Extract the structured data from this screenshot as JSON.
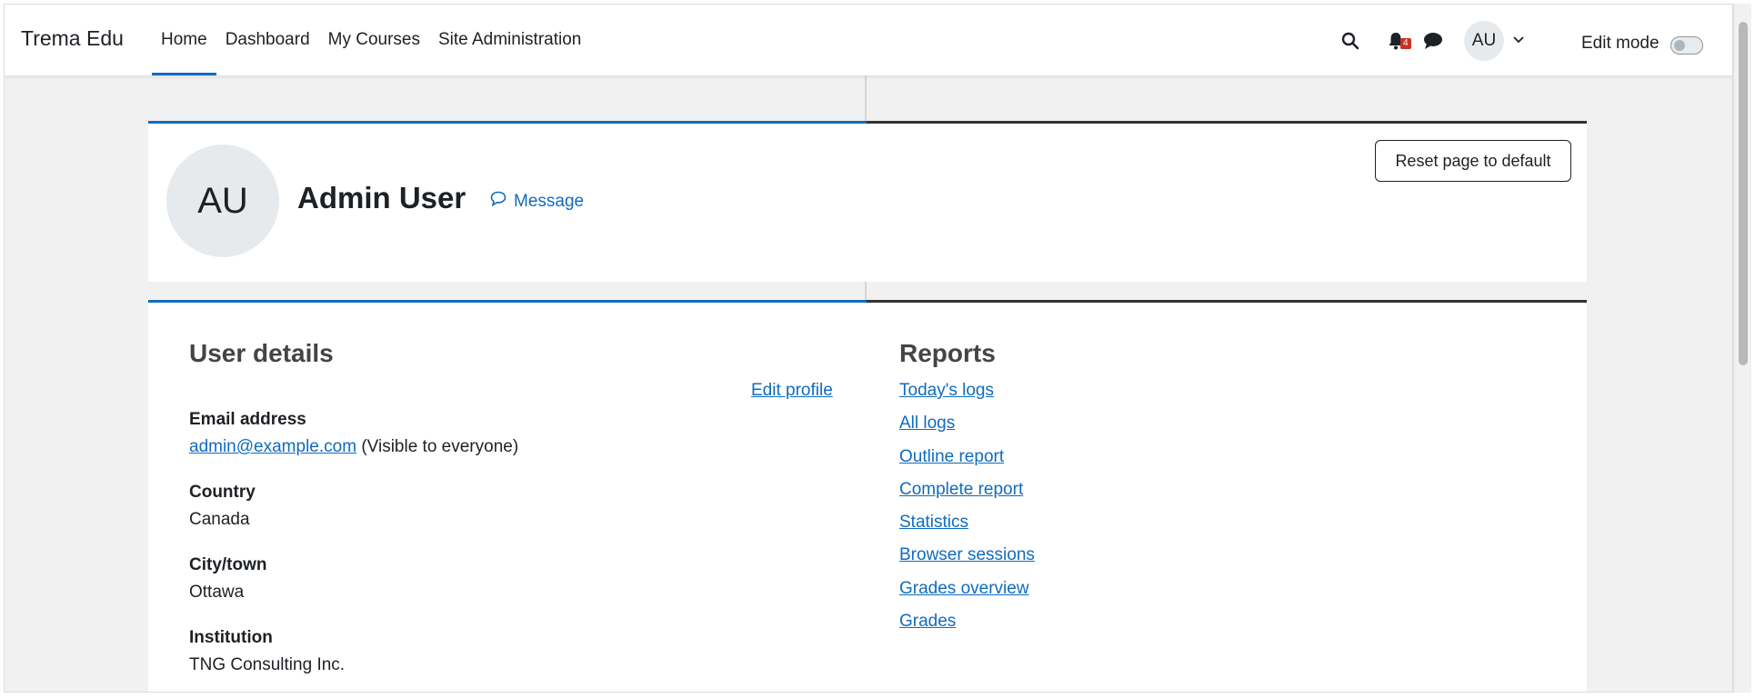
{
  "navbar": {
    "brand": "Trema Edu",
    "links": [
      {
        "label": "Home",
        "active": true
      },
      {
        "label": "Dashboard",
        "active": false
      },
      {
        "label": "My Courses",
        "active": false
      },
      {
        "label": "Site Administration",
        "active": false
      }
    ],
    "notification_count": "4",
    "user_initials": "AU",
    "edit_mode_label": "Edit mode",
    "edit_mode_on": false
  },
  "profile": {
    "initials": "AU",
    "name": "Admin User",
    "message_label": "Message",
    "reset_label": "Reset page to default"
  },
  "user_details": {
    "title": "User details",
    "edit_profile_label": "Edit profile",
    "fields": {
      "email": {
        "label": "Email address",
        "value": "admin@example.com",
        "note": "(Visible to everyone)"
      },
      "country": {
        "label": "Country",
        "value": "Canada"
      },
      "city": {
        "label": "City/town",
        "value": "Ottawa"
      },
      "institution": {
        "label": "Institution",
        "value": "TNG Consulting Inc."
      }
    }
  },
  "reports": {
    "title": "Reports",
    "links": [
      "Today's logs",
      "All logs",
      "Outline report",
      "Complete report",
      "Statistics",
      "Browser sessions",
      "Grades overview",
      "Grades"
    ]
  },
  "colors": {
    "accent": "#0f6cbf",
    "badge": "#ca3120"
  },
  "icons": [
    "search-icon",
    "bell-icon",
    "chat-icon",
    "chevron-down-icon",
    "message-icon"
  ]
}
